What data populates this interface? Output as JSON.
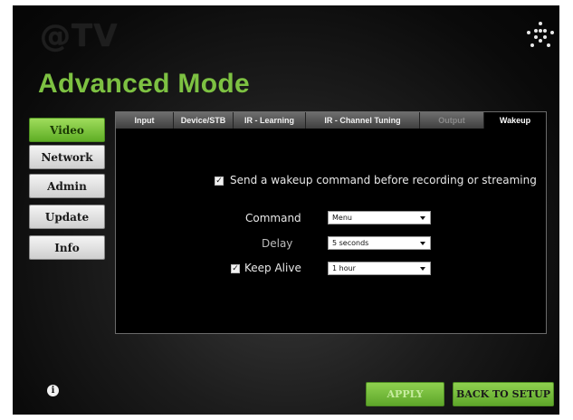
{
  "header": {
    "logo_text": "@TV",
    "title": "Advanced Mode",
    "corner_icon": "dotted-logo-icon"
  },
  "sidebar": {
    "items": [
      {
        "label": "Video",
        "active": true
      },
      {
        "label": "Network",
        "active": false
      },
      {
        "label": "Admin",
        "active": false
      },
      {
        "label": "Update",
        "active": false
      },
      {
        "label": "Info",
        "active": false
      }
    ]
  },
  "tabs": [
    {
      "label": "Input",
      "state": "normal"
    },
    {
      "label": "Device/STB",
      "state": "normal"
    },
    {
      "label": "IR - Learning",
      "state": "normal"
    },
    {
      "label": "IR - Channel Tuning",
      "state": "normal"
    },
    {
      "label": "Output",
      "state": "disabled"
    },
    {
      "label": "Wakeup",
      "state": "active"
    }
  ],
  "wakeup": {
    "send_wakeup": {
      "label": "Send a wakeup command before recording or streaming",
      "checked": true
    },
    "command": {
      "label": "Command",
      "value": "Menu"
    },
    "delay": {
      "label": "Delay",
      "value": "5 seconds"
    },
    "keep_alive": {
      "label": "Keep Alive",
      "value": "1 hour",
      "checked": true
    }
  },
  "footer": {
    "info_icon": "info-icon",
    "info_glyph": "i",
    "apply_label": "APPLY",
    "back_label": "BACK TO SETUP"
  },
  "colors": {
    "accent_green": "#7dc142",
    "button_green": "#5ea62a",
    "background": "#1c1c1c"
  }
}
